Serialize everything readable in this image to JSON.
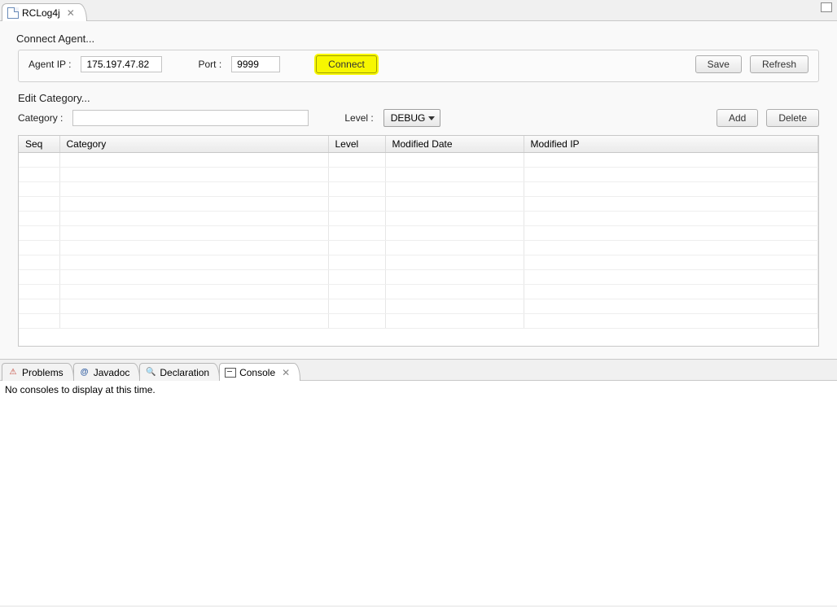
{
  "top_tab": {
    "title": "RCLog4j"
  },
  "connect": {
    "group_title": "Connect Agent...",
    "agent_ip_label": "Agent IP :",
    "agent_ip_value": "175.197.47.82",
    "port_label": "Port :",
    "port_value": "9999",
    "connect_label": "Connect",
    "save_label": "Save",
    "refresh_label": "Refresh"
  },
  "edit": {
    "group_title": "Edit Category...",
    "category_label": "Category :",
    "category_value": "",
    "level_label": "Level :",
    "level_selected": "DEBUG",
    "add_label": "Add",
    "delete_label": "Delete"
  },
  "table": {
    "columns": {
      "seq": "Seq",
      "category": "Category",
      "level": "Level",
      "modified_date": "Modified Date",
      "modified_ip": "Modified IP"
    }
  },
  "bottom_tabs": {
    "problems": "Problems",
    "javadoc": "Javadoc",
    "declaration": "Declaration",
    "console": "Console"
  },
  "console": {
    "empty_message": "No consoles to display at this time."
  }
}
